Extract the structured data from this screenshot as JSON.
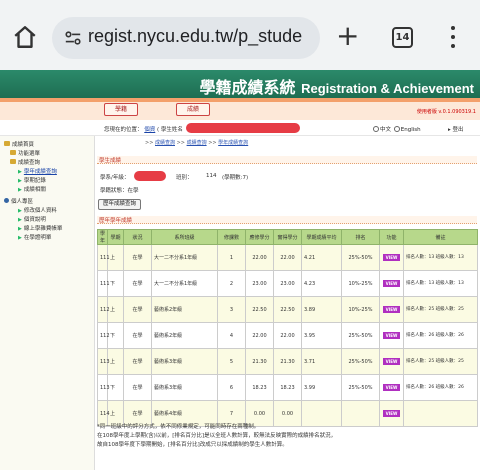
{
  "browser": {
    "url": "regist.nycu.edu.tw/p_stude",
    "tab_count": "14"
  },
  "header": {
    "title_zh": "學籍成績系統",
    "title_en": "Registration & Achievement",
    "version": "使用者版 v.0.1.090319.1"
  },
  "nav": {
    "btn1": "學籍",
    "btn2": "成績"
  },
  "info": {
    "prefix": "您現在的位置：",
    "user_link": "個資",
    "user_label": "( 學生姓名",
    "lang_zh": "中文",
    "lang_en": "English",
    "logout": "登出"
  },
  "breadcrumb": {
    "sep": ">>",
    "a": "成績查詢",
    "b": "成績查詢",
    "c": "學年成績查詢"
  },
  "sidebar": {
    "items": [
      {
        "label": "成績首頁"
      },
      {
        "label": "功能選單"
      },
      {
        "label": "成績查詢"
      },
      {
        "label": "學年成績查詢"
      },
      {
        "label": "學期記錄"
      },
      {
        "label": "成績相關"
      },
      {
        "label": "個人專區"
      },
      {
        "label": "修改個人資料"
      },
      {
        "label": "個資說明"
      },
      {
        "label": "線上學雜費帳單"
      },
      {
        "label": "在學證明單"
      }
    ]
  },
  "main": {
    "section1": "學生成績",
    "dept_label": "學系/年級：",
    "class_label": "班別：",
    "class_value": "114",
    "year_note": "(學期數:7)",
    "status_label": "學籍狀態：",
    "status_value": "在學",
    "grade_button": "歷年成績查詢",
    "section2": "歷年學年成績",
    "headers": [
      "學年",
      "學期",
      "狀況",
      "系所班級",
      "修課數",
      "應修學分",
      "實得學分",
      "學期成績平均",
      "排名",
      "功能",
      "備註"
    ],
    "rows": [
      {
        "year": "111",
        "sem": "上",
        "status": "在學",
        "cls": "大一二不分系1年級",
        "n": "1",
        "req": "22.00",
        "got": "22.00",
        "avg": "4.21",
        "rank": "25%-50%",
        "view": "VIEW",
        "note": "排名人數：13 班級人數：13"
      },
      {
        "year": "111",
        "sem": "下",
        "status": "在學",
        "cls": "大一二不分系1年級",
        "n": "2",
        "req": "23.00",
        "got": "23.00",
        "avg": "4.23",
        "rank": "10%-25%",
        "view": "VIEW",
        "note": "排名人數：13 班級人數：13"
      },
      {
        "year": "112",
        "sem": "上",
        "status": "在學",
        "cls": "藝術系2年級",
        "n": "3",
        "req": "22.50",
        "got": "22.50",
        "avg": "3.89",
        "rank": "10%-25%",
        "view": "VIEW",
        "note": "排名人數：25 班級人數：25"
      },
      {
        "year": "112",
        "sem": "下",
        "status": "在學",
        "cls": "藝術系2年級",
        "n": "4",
        "req": "22.00",
        "got": "22.00",
        "avg": "3.95",
        "rank": "25%-50%",
        "view": "VIEW",
        "note": "排名人數：26 班級人數：26"
      },
      {
        "year": "113",
        "sem": "上",
        "status": "在學",
        "cls": "藝術系3年級",
        "n": "5",
        "req": "21.30",
        "got": "21.30",
        "avg": "3.71",
        "rank": "25%-50%",
        "view": "VIEW",
        "note": "排名人數：25 班級人數：25"
      },
      {
        "year": "113",
        "sem": "下",
        "status": "在學",
        "cls": "藝術系3年級",
        "n": "6",
        "req": "18.23",
        "got": "18.23",
        "avg": "3.99",
        "rank": "25%-50%",
        "view": "VIEW",
        "note": "排名人數：26 班級人數：26"
      },
      {
        "year": "114",
        "sem": "上",
        "status": "在學",
        "cls": "藝術系4年級",
        "n": "7",
        "req": "0.00",
        "got": "0.00",
        "avg": "",
        "rank": "",
        "view": "VIEW",
        "note": ""
      }
    ]
  },
  "footnotes": [
    "*同一班級中的評分方式，依不同修業規定，可能同時存在兩種制。",
    "在108學年度上學期(含)以前，[排名百分比]是以全班人數計算，較無法反映實際的成績排名狀況，",
    "故自108學年度下學期開始，[排名百分比]改成只以採成績制的學生人數計算。"
  ]
}
